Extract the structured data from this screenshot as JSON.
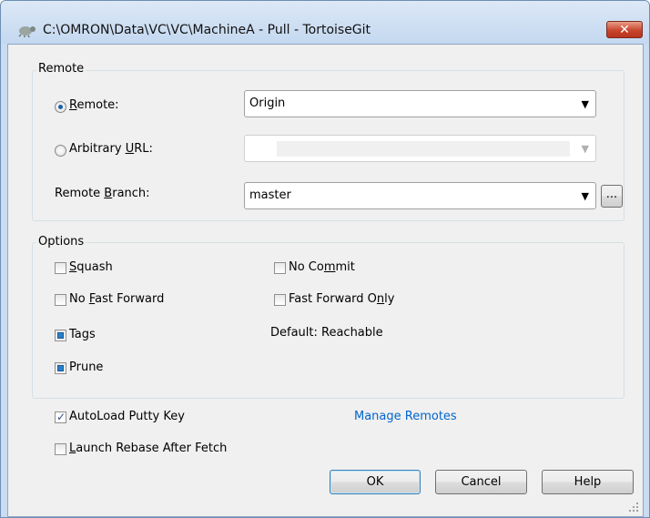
{
  "window": {
    "title": "C:\\OMRON\\Data\\VC\\VC\\MachineA - Pull - TortoiseGit",
    "close_label": "✕"
  },
  "remote_group": {
    "label": "Remote",
    "remote_radio": {
      "label_prefix": "",
      "label_u": "R",
      "label_rest": "emote:",
      "selected": true
    },
    "remote_combo": {
      "value": "Origin"
    },
    "url_radio": {
      "label_prefix": "Arbitrary ",
      "label_u": "U",
      "label_rest": "RL:",
      "selected": false
    },
    "url_combo": {
      "value": ""
    },
    "branch_label": {
      "prefix": "Remote ",
      "u": "B",
      "rest": "ranch:"
    },
    "branch_combo": {
      "value": "master"
    },
    "browse_label": "..."
  },
  "options_group": {
    "label": "Options",
    "squash": {
      "prefix": "",
      "u": "S",
      "rest": "quash",
      "checked": false
    },
    "no_commit": {
      "prefix": "No Co",
      "u": "m",
      "rest": "mit",
      "checked": false
    },
    "no_ff": {
      "prefix": "No ",
      "u": "F",
      "rest": "ast Forward",
      "checked": false
    },
    "ff_only": {
      "prefix": "Fast Forward O",
      "u": "n",
      "rest": "ly",
      "checked": false
    },
    "tags": {
      "label": "Tags",
      "state": "indeterminate"
    },
    "tags_default": "Default: Reachable",
    "prune": {
      "label": "Prune",
      "state": "indeterminate"
    }
  },
  "autoload": {
    "label": "AutoLoad Putty Key",
    "checked": true
  },
  "launch_rebase": {
    "prefix": "",
    "u": "L",
    "rest": "aunch Rebase After Fetch",
    "checked": false
  },
  "manage_remotes": "Manage Remotes",
  "buttons": {
    "ok": "OK",
    "cancel": "Cancel",
    "help": "Help"
  }
}
